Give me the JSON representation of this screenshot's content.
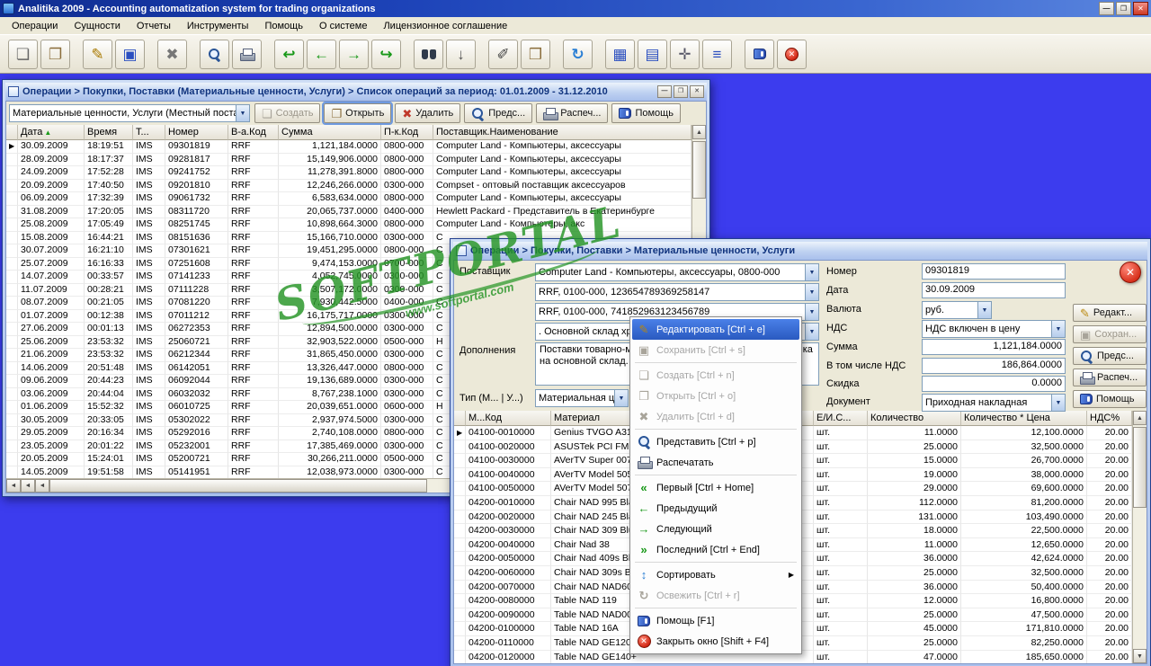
{
  "app": {
    "title": "Analitika 2009 - Accounting automatization system for trading organizations",
    "menu": [
      "Операции",
      "Сущности",
      "Отчеты",
      "Инструменты",
      "Помощь",
      "О системе",
      "Лицензионное соглашение"
    ],
    "window_buttons": {
      "minimize": "—",
      "maximize": "❐",
      "close": "✕"
    }
  },
  "toolbar": {
    "icons": [
      {
        "name": "new-document",
        "glyph": "❏",
        "color": "#666666"
      },
      {
        "name": "open-document",
        "glyph": "❐",
        "color": "#8a6d3b"
      },
      {
        "sep": true
      },
      {
        "name": "edit-document",
        "glyph": "✎",
        "color": "#a87900"
      },
      {
        "name": "save",
        "glyph": "▣",
        "color": "#2b4fc0"
      },
      {
        "sep": true
      },
      {
        "name": "delete",
        "glyph": "✖",
        "color": "#777777"
      },
      {
        "sep": true
      },
      {
        "name": "search",
        "css": "icmag"
      },
      {
        "name": "print",
        "css": "icprint"
      },
      {
        "sep": true
      },
      {
        "name": "undo",
        "glyph": "↩",
        "color": "#189818"
      },
      {
        "name": "previous",
        "glyph": "←",
        "color": "#189818"
      },
      {
        "name": "next",
        "glyph": "→",
        "color": "#189818"
      },
      {
        "name": "redo",
        "glyph": "↪",
        "color": "#189818"
      },
      {
        "sep": true
      },
      {
        "name": "binoculars",
        "css": "icbinoc"
      },
      {
        "name": "download",
        "glyph": "↓",
        "color": "#555555"
      },
      {
        "sep": true
      },
      {
        "name": "sign",
        "glyph": "✐",
        "color": "#444444"
      },
      {
        "name": "paste",
        "glyph": "❒",
        "color": "#8a6d3b"
      },
      {
        "sep": true
      },
      {
        "name": "refresh",
        "glyph": "↻",
        "color": "#2b7fd4"
      },
      {
        "sep": true
      },
      {
        "name": "table-view",
        "glyph": "▦",
        "color": "#2b4fc0"
      },
      {
        "name": "table-grid",
        "glyph": "▤",
        "color": "#2b4fc0"
      },
      {
        "name": "settings",
        "glyph": "✛",
        "color": "#555566"
      },
      {
        "name": "database",
        "glyph": "≡",
        "color": "#2b4fc0"
      },
      {
        "sep": true
      },
      {
        "name": "help-book",
        "css": "icbook"
      },
      {
        "name": "exit",
        "css": "icexit"
      }
    ]
  },
  "list_window": {
    "title": "Операции > Покупки, Поставки (Материальные ценности, Услуги) > Список операций за период: 01.01.2009 - 31.12.2010",
    "filter_combo": "Материальные ценности, Услуги (Местный поставщ",
    "buttons": [
      {
        "name": "create-button",
        "label": "Создать",
        "icon": "new",
        "state": "disabled"
      },
      {
        "name": "open-button",
        "label": "Открыть",
        "icon": "open",
        "state": "focused"
      },
      {
        "name": "delete-button",
        "label": "Удалить",
        "icon": "del",
        "state": ""
      },
      {
        "name": "preview-button",
        "label": "Предс...",
        "icon": "search",
        "state": ""
      },
      {
        "name": "print-button",
        "label": "Распеч...",
        "icon": "print",
        "state": ""
      },
      {
        "name": "help-button",
        "label": "Помощь",
        "icon": "help",
        "state": ""
      }
    ],
    "columns": [
      "Дата",
      "Время",
      "Т...",
      "Номер",
      "В-а.Код",
      "Сумма",
      "П-к.Код",
      "Поставщик.Наименование"
    ],
    "sort_column": 0,
    "rows": [
      {
        "date": "30.09.2009",
        "time": "18:19:51",
        "type": "IMS",
        "number": "09301819",
        "currency": "RRF",
        "sum": "1,121,184.0000",
        "code": "0800-000",
        "supplier": "Computer Land - Компьютеры, аксессуары"
      },
      {
        "date": "28.09.2009",
        "time": "18:17:37",
        "type": "IMS",
        "number": "09281817",
        "currency": "RRF",
        "sum": "15,149,906.0000",
        "code": "0800-000",
        "supplier": "Computer Land - Компьютеры, аксессуары"
      },
      {
        "date": "24.09.2009",
        "time": "17:52:28",
        "type": "IMS",
        "number": "09241752",
        "currency": "RRF",
        "sum": "11,278,391.8000",
        "code": "0800-000",
        "supplier": "Computer Land - Компьютеры, аксессуары"
      },
      {
        "date": "20.09.2009",
        "time": "17:40:50",
        "type": "IMS",
        "number": "09201810",
        "currency": "RRF",
        "sum": "12,246,266.0000",
        "code": "0300-000",
        "supplier": "Compset - оптовый поставщик аксессуаров"
      },
      {
        "date": "06.09.2009",
        "time": "17:32:39",
        "type": "IMS",
        "number": "09061732",
        "currency": "RRF",
        "sum": "6,583,634.0000",
        "code": "0800-000",
        "supplier": "Computer Land - Компьютеры, аксессуары"
      },
      {
        "date": "31.08.2009",
        "time": "17:20:05",
        "type": "IMS",
        "number": "08311720",
        "currency": "RRF",
        "sum": "20,065,737.0000",
        "code": "0400-000",
        "supplier": "Hewlett Packard - Представитель в Екатеринбурге"
      },
      {
        "date": "25.08.2009",
        "time": "17:05:49",
        "type": "IMS",
        "number": "08251745",
        "currency": "RRF",
        "sum": "10,898,664.3000",
        "code": "0800-000",
        "supplier": "Computer Land - Компьютеры, акс"
      },
      {
        "date": "15.08.2009",
        "time": "16:44:21",
        "type": "IMS",
        "number": "08151636",
        "currency": "RRF",
        "sum": "15,166,710.0000",
        "code": "0300-000",
        "supplier": "C"
      },
      {
        "date": "30.07.2009",
        "time": "16:21:10",
        "type": "IMS",
        "number": "07301621",
        "currency": "RRF",
        "sum": "19,451,295.0000",
        "code": "0800-000",
        "supplier": "C"
      },
      {
        "date": "25.07.2009",
        "time": "16:16:33",
        "type": "IMS",
        "number": "07251608",
        "currency": "RRF",
        "sum": "9,474,153.0000",
        "code": "0700-000",
        "supplier": "C"
      },
      {
        "date": "14.07.2009",
        "time": "00:33:57",
        "type": "IMS",
        "number": "07141233",
        "currency": "RRF",
        "sum": "4,052,745.0000",
        "code": "0300-000",
        "supplier": "C"
      },
      {
        "date": "11.07.2009",
        "time": "00:28:21",
        "type": "IMS",
        "number": "07111228",
        "currency": "RRF",
        "sum": "3,507,172.0000",
        "code": "0300-000",
        "supplier": "C"
      },
      {
        "date": "08.07.2009",
        "time": "00:21:05",
        "type": "IMS",
        "number": "07081220",
        "currency": "RRF",
        "sum": "7,930,442.5000",
        "code": "0400-000",
        "supplier": "C"
      },
      {
        "date": "01.07.2009",
        "time": "00:12:38",
        "type": "IMS",
        "number": "07011212",
        "currency": "RRF",
        "sum": "16,175,717.0000",
        "code": "0300-000",
        "supplier": "C"
      },
      {
        "date": "27.06.2009",
        "time": "00:01:13",
        "type": "IMS",
        "number": "06272353",
        "currency": "RRF",
        "sum": "12,894,500.0000",
        "code": "0300-000",
        "supplier": "C"
      },
      {
        "date": "25.06.2009",
        "time": "23:53:32",
        "type": "IMS",
        "number": "25060721",
        "currency": "RRF",
        "sum": "32,903,522.0000",
        "code": "0500-000",
        "supplier": "H"
      },
      {
        "date": "21.06.2009",
        "time": "23:53:32",
        "type": "IMS",
        "number": "06212344",
        "currency": "RRF",
        "sum": "31,865,450.0000",
        "code": "0300-000",
        "supplier": "C"
      },
      {
        "date": "14.06.2009",
        "time": "20:51:48",
        "type": "IMS",
        "number": "06142051",
        "currency": "RRF",
        "sum": "13,326,447.0000",
        "code": "0800-000",
        "supplier": "C"
      },
      {
        "date": "09.06.2009",
        "time": "20:44:23",
        "type": "IMS",
        "number": "06092044",
        "currency": "RRF",
        "sum": "19,136,689.0000",
        "code": "0300-000",
        "supplier": "C"
      },
      {
        "date": "03.06.2009",
        "time": "20:44:04",
        "type": "IMS",
        "number": "06032032",
        "currency": "RRF",
        "sum": "8,767,238.1000",
        "code": "0300-000",
        "supplier": "C"
      },
      {
        "date": "01.06.2009",
        "time": "15:52:32",
        "type": "IMS",
        "number": "06010725",
        "currency": "RRF",
        "sum": "20,039,651.0000",
        "code": "0600-000",
        "supplier": "H"
      },
      {
        "date": "30.05.2009",
        "time": "20:33:05",
        "type": "IMS",
        "number": "05302022",
        "currency": "RRF",
        "sum": "2,937,974.5000",
        "code": "0300-000",
        "supplier": "C"
      },
      {
        "date": "29.05.2009",
        "time": "20:16:34",
        "type": "IMS",
        "number": "05292016",
        "currency": "RRF",
        "sum": "2,740,108.0000",
        "code": "0800-000",
        "supplier": "C"
      },
      {
        "date": "23.05.2009",
        "time": "20:01:22",
        "type": "IMS",
        "number": "05232001",
        "currency": "RRF",
        "sum": "17,385,469.0000",
        "code": "0300-000",
        "supplier": "C"
      },
      {
        "date": "20.05.2009",
        "time": "15:24:01",
        "type": "IMS",
        "number": "05200721",
        "currency": "RRF",
        "sum": "30,266,211.0000",
        "code": "0500-000",
        "supplier": "C"
      },
      {
        "date": "14.05.2009",
        "time": "19:51:58",
        "type": "IMS",
        "number": "05141951",
        "currency": "RRF",
        "sum": "12,038,973.0000",
        "code": "0300-000",
        "supplier": "C"
      }
    ]
  },
  "detail_window": {
    "title": "Операции > Покупки, Поставки > Материальные ценности, Услуги",
    "form": {
      "supplier_label": "Поставщик",
      "supplier": "Computer Land - Компьютеры, аксессуары, 0800-000",
      "account1": "RRF, 0100-000, 123654789369258147",
      "account2": "RRF, 0100-000, 741852963123456789",
      "warehouse": ". Основной склад хранения",
      "notes_label": "Дополнения",
      "notes": "Поставки товарно-материальных ценностей от поставщика на основной склад.",
      "type_label": "Тип (М... | У...)",
      "type": "Материальная ценность",
      "number_label": "Номер",
      "number": "09301819",
      "date_label": "Дата",
      "date": "30.09.2009",
      "currency_label": "Валюта",
      "currency": "руб.",
      "vat_label": "НДС",
      "vat_mode": "НДС включен в цену",
      "sum_label": "Сумма",
      "sum": "1,121,184.0000",
      "vat_sum_label": "В том числе НДС",
      "vat_sum": "186,864.0000",
      "discount_label": "Скидка",
      "discount": "0.0000",
      "document_label": "Документ",
      "document": "Приходная накладная"
    },
    "side_buttons": [
      {
        "name": "edit-button",
        "label": "Редакт...",
        "icon": "edit",
        "state": ""
      },
      {
        "name": "save-button",
        "label": "Сохран...",
        "icon": "save",
        "state": "disabled"
      },
      {
        "name": "preview-button",
        "label": "Предс...",
        "icon": "search",
        "state": ""
      },
      {
        "name": "print-button",
        "label": "Распеч...",
        "icon": "print",
        "state": ""
      },
      {
        "name": "help-button",
        "label": "Помощь",
        "icon": "help",
        "state": ""
      }
    ],
    "items_columns": [
      "М...Код",
      "Материал",
      "Е/И.С...",
      "Количество",
      "Количество * Цена",
      "НДС%"
    ],
    "items": [
      {
        "code": "04100-0010000",
        "name": "Genius TVGO A31",
        "unit": "шт.",
        "qty": "11.0000",
        "total": "12,100.0000",
        "vat": "20.00"
      },
      {
        "code": "04100-0020000",
        "name": "ASUSTek PCI FM П",
        "unit": "шт.",
        "qty": "25.0000",
        "total": "32,500.0000",
        "vat": "20.00"
      },
      {
        "code": "04100-0030000",
        "name": "AVerTV Super 007 (",
        "unit": "шт.",
        "qty": "15.0000",
        "total": "26,700.0000",
        "vat": "20.00"
      },
      {
        "code": "04100-0040000",
        "name": "AVerTV Model 505 (",
        "unit": "шт.",
        "qty": "19.0000",
        "total": "38,000.0000",
        "vat": "20.00"
      },
      {
        "code": "04100-0050000",
        "name": "AVerTV Model 507 (",
        "unit": "шт.",
        "qty": "29.0000",
        "total": "69,600.0000",
        "vat": "20.00"
      },
      {
        "code": "04200-0010000",
        "name": "Chair NAD 995 Blac",
        "unit": "шт.",
        "qty": "112.0000",
        "total": "81,200.0000",
        "vat": "20.00"
      },
      {
        "code": "04200-0020000",
        "name": "Chair NAD 245 Blac",
        "unit": "шт.",
        "qty": "131.0000",
        "total": "103,490.0000",
        "vat": "20.00"
      },
      {
        "code": "04200-0030000",
        "name": "Chair NAD 309 Blue",
        "unit": "шт.",
        "qty": "18.0000",
        "total": "22,500.0000",
        "vat": "20.00"
      },
      {
        "code": "04200-0040000",
        "name": "Chair Nad 38",
        "unit": "шт.",
        "qty": "11.0000",
        "total": "12,650.0000",
        "vat": "20.00"
      },
      {
        "code": "04200-0050000",
        "name": "Chair Nad 409s Blac",
        "unit": "шт.",
        "qty": "36.0000",
        "total": "42,624.0000",
        "vat": "20.00"
      },
      {
        "code": "04200-0060000",
        "name": "Chair NAD 309s Blac",
        "unit": "шт.",
        "qty": "25.0000",
        "total": "32,500.0000",
        "vat": "20.00"
      },
      {
        "code": "04200-0070000",
        "name": "Chair NAD NAD609S",
        "unit": "шт.",
        "qty": "36.0000",
        "total": "50,400.0000",
        "vat": "20.00"
      },
      {
        "code": "04200-0080000",
        "name": "Table NAD 119",
        "unit": "шт.",
        "qty": "12.0000",
        "total": "16,800.0000",
        "vat": "20.00"
      },
      {
        "code": "04200-0090000",
        "name": "Table NAD NAD0020",
        "unit": "шт.",
        "qty": "25.0000",
        "total": "47,500.0000",
        "vat": "20.00"
      },
      {
        "code": "04200-0100000",
        "name": "Table NAD 16A",
        "unit": "шт.",
        "qty": "45.0000",
        "total": "171,810.0000",
        "vat": "20.00"
      },
      {
        "code": "04200-0110000",
        "name": "Table NAD GE120+",
        "unit": "шт.",
        "qty": "25.0000",
        "total": "82,250.0000",
        "vat": "20.00"
      },
      {
        "code": "04200-0120000",
        "name": "Table NAD GE140+",
        "unit": "шт.",
        "qty": "47.0000",
        "total": "185,650.0000",
        "vat": "20.00"
      }
    ]
  },
  "context_menu": {
    "items": [
      {
        "name": "edit",
        "label": "Редактировать [Ctrl + e]",
        "icon": "edit",
        "state": "selected"
      },
      {
        "name": "save",
        "label": "Сохранить [Ctrl + s]",
        "icon": "save",
        "state": "disabled"
      },
      {
        "sep": true
      },
      {
        "name": "create",
        "label": "Создать [Ctrl + n]",
        "icon": "new",
        "state": "disabled"
      },
      {
        "name": "open",
        "label": "Открыть [Ctrl + o]",
        "icon": "open",
        "state": "disabled"
      },
      {
        "name": "delete",
        "label": "Удалить [Ctrl + d]",
        "icon": "del",
        "state": "disabled"
      },
      {
        "sep": true
      },
      {
        "name": "preview",
        "label": "Представить [Ctrl + p]",
        "icon": "search",
        "state": ""
      },
      {
        "name": "print",
        "label": "Распечатать",
        "icon": "print",
        "state": ""
      },
      {
        "sep": true
      },
      {
        "name": "first",
        "label": "Первый [Ctrl + Home]",
        "icon": "first",
        "state": ""
      },
      {
        "name": "previous",
        "label": "Предыдущий",
        "icon": "previous",
        "state": ""
      },
      {
        "name": "next",
        "label": "Следующий",
        "icon": "next",
        "state": ""
      },
      {
        "name": "last",
        "label": "Последний [Ctrl + End]",
        "icon": "last",
        "state": ""
      },
      {
        "sep": true
      },
      {
        "name": "sort",
        "label": "Сортировать",
        "icon": "sort",
        "state": "",
        "submenu": true
      },
      {
        "name": "refresh",
        "label": "Освежить [Ctrl + r]",
        "icon": "refresh",
        "state": "disabled"
      },
      {
        "sep": true
      },
      {
        "name": "help",
        "label": "Помощь [F1]",
        "icon": "help",
        "state": ""
      },
      {
        "name": "close-window",
        "label": "Закрыть окно [Shift + F4]",
        "icon": "exit",
        "state": ""
      }
    ]
  },
  "stamp": {
    "text": "SOFTPORTAL",
    "url": "www.softportal.com"
  }
}
